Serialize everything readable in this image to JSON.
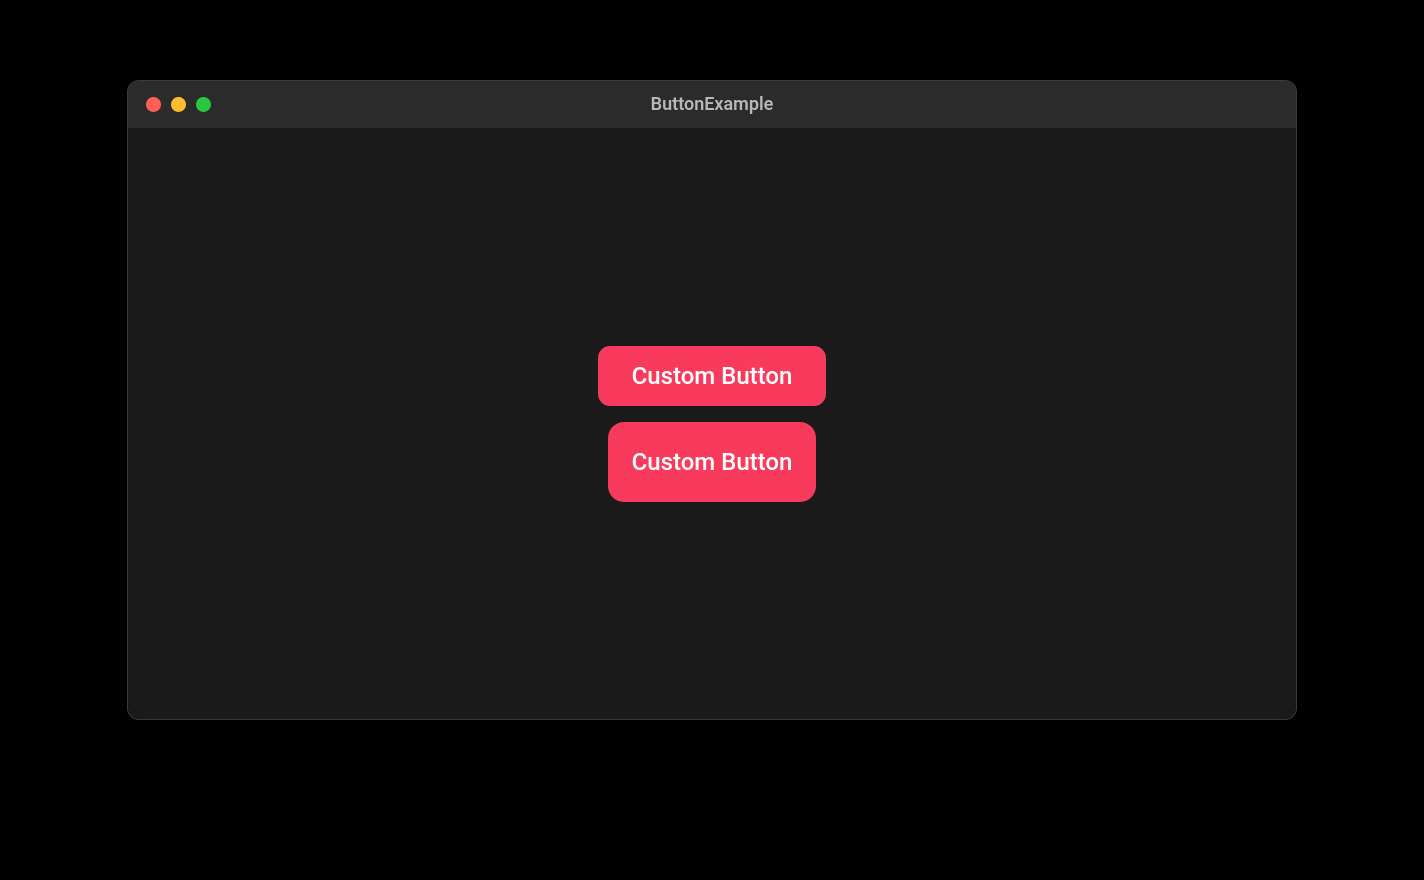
{
  "window": {
    "title": "ButtonExample"
  },
  "buttons": [
    {
      "label": "Custom Button"
    },
    {
      "label": "Custom Button"
    }
  ],
  "colors": {
    "button_bg": "#f83a5c",
    "button_fg": "#ffffff",
    "window_bg": "#1a1a1a",
    "titlebar_bg": "#2b2b2b"
  }
}
